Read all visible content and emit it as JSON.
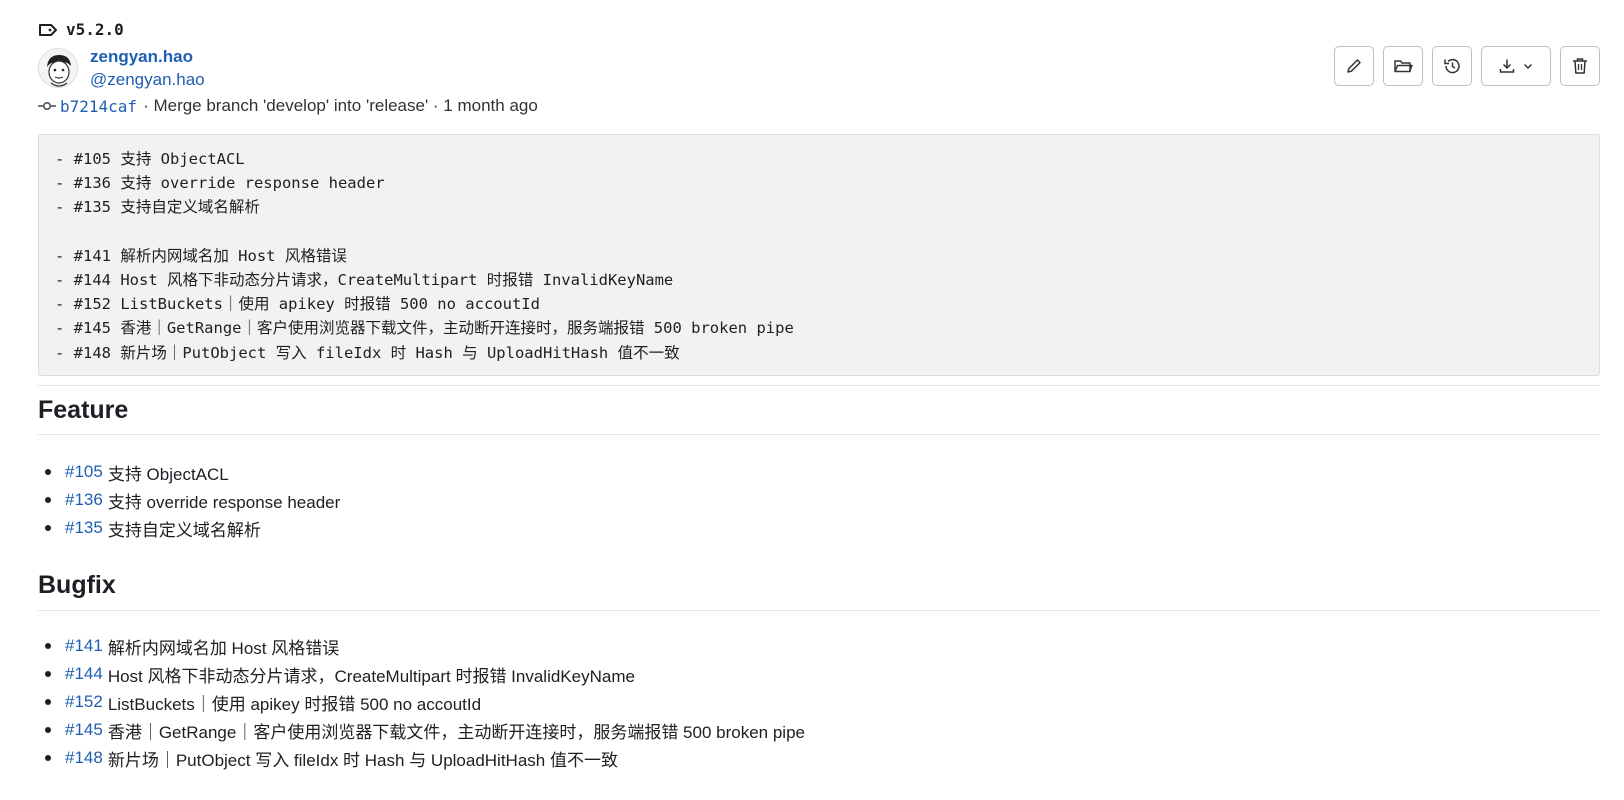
{
  "release": {
    "tag": "v5.2.0"
  },
  "author": {
    "name": "zengyan.hao",
    "handle": "@zengyan.hao"
  },
  "commit": {
    "sha": "b7214caf",
    "message": "· Merge branch 'develop' into 'release' · 1 month ago"
  },
  "actions": {
    "edit": "pencil-icon",
    "browse": "folder-icon",
    "history": "history-icon",
    "download": "download-icon",
    "delete": "trash-icon"
  },
  "notes_raw": "- #105 支持 ObjectACL\n- #136 支持 override response header\n- #135 支持自定义域名解析\n\n- #141 解析内网域名加 Host 风格错误\n- #144 Host 风格下非动态分片请求，CreateMultipart 时报错 InvalidKeyName\n- #152 ListBuckets｜使用 apikey 时报错 500 no accoutId\n- #145 香港｜GetRange｜客户使用浏览器下载文件，主动断开连接时，服务端报错 500 broken pipe\n- #148 新片场｜PutObject 写入 fileIdx 时 Hash 与 UploadHitHash 值不一致",
  "feature": {
    "title": "Feature",
    "items": [
      {
        "ref": "#105",
        "text": "支持 ObjectACL"
      },
      {
        "ref": "#136",
        "text": "支持 override response header"
      },
      {
        "ref": "#135",
        "text": "支持自定义域名解析"
      }
    ]
  },
  "bugfix": {
    "title": "Bugfix",
    "items": [
      {
        "ref": "#141",
        "text": "解析内网域名加 Host 风格错误"
      },
      {
        "ref": "#144",
        "text": "Host 风格下非动态分片请求，CreateMultipart 时报错 InvalidKeyName"
      },
      {
        "ref": "#152",
        "text": "ListBuckets｜使用 apikey 时报错 500 no accoutId"
      },
      {
        "ref": "#145",
        "text": "香港｜GetRange｜客户使用浏览器下载文件，主动断开连接时，服务端报错 500 broken pipe"
      },
      {
        "ref": "#148",
        "text": "新片场｜PutObject 写入 fileIdx 时 Hash 与 UploadHitHash 值不一致"
      }
    ]
  }
}
